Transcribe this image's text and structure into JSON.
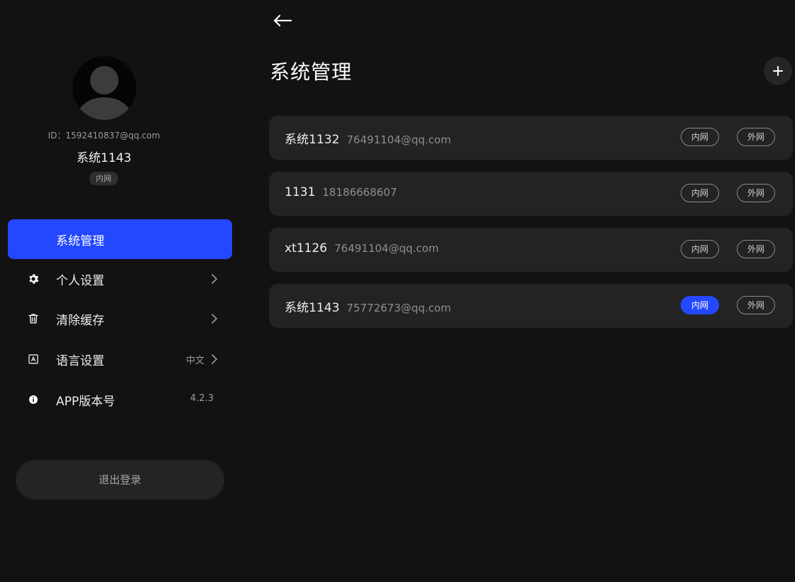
{
  "profile": {
    "id_text": "ID：1592410837@qq.com",
    "name": "系统1143",
    "badge": "内网"
  },
  "sidebar": {
    "active_item": {
      "label": "系统管理"
    },
    "items": [
      {
        "icon": "gear-icon",
        "label": "个人设置",
        "value": "",
        "has_chevron": true
      },
      {
        "icon": "trash-icon",
        "label": "清除缓存",
        "value": "",
        "has_chevron": true
      },
      {
        "icon": "language-icon",
        "label": "语言设置",
        "value": "中文",
        "has_chevron": true
      },
      {
        "icon": "info-icon",
        "label": "APP版本号",
        "value": "4.2.3",
        "has_chevron": false
      }
    ],
    "logout_label": "退出登录"
  },
  "main": {
    "title": "系统管理",
    "systems": [
      {
        "name": "系统1132",
        "contact": "76491104@qq.com",
        "intranet": "内网",
        "extranet": "外网",
        "selected": "none"
      },
      {
        "name": "1131",
        "contact": "18186668607",
        "intranet": "内网",
        "extranet": "外网",
        "selected": "none"
      },
      {
        "name": "xt1126",
        "contact": "76491104@qq.com",
        "intranet": "内网",
        "extranet": "外网",
        "selected": "none"
      },
      {
        "name": "系统1143",
        "contact": "75772673@qq.com",
        "intranet": "内网",
        "extranet": "外网",
        "selected": "intranet"
      }
    ]
  },
  "colors": {
    "accent": "#2448ff",
    "background": "#121212",
    "card": "#232323"
  }
}
